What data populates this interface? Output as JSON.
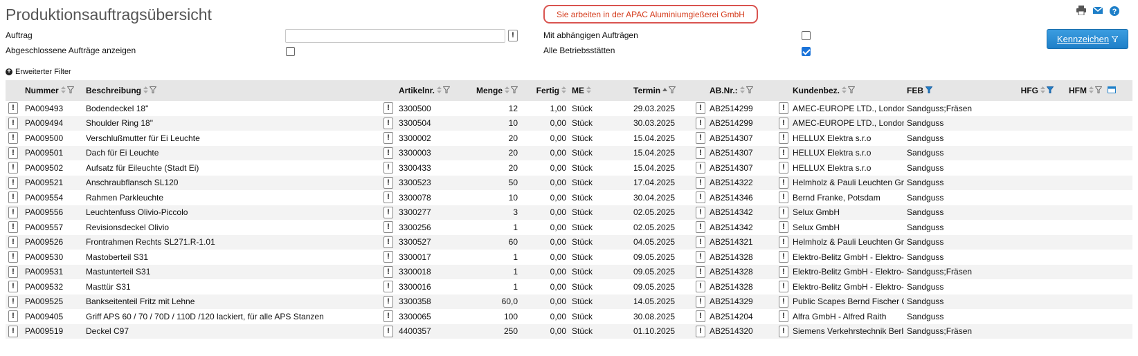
{
  "header": {
    "title": "Produktionsauftragsübersicht",
    "plant_notice": "Sie arbeiten in der APAC Aluminiumgießerei GmbH"
  },
  "filters": {
    "auftrag_label": "Auftrag",
    "auftrag_value": "",
    "abgeschlossene_label": "Abgeschlossene Aufträge anzeigen",
    "abgeschlossene_checked": false,
    "abhaengige_label": "Mit abhängigen Aufträgen",
    "abhaengige_checked": false,
    "betriebsstaetten_label": "Alle Betriebsstätten",
    "betriebsstaetten_checked": true,
    "kennzeichen_button": "Kennzeichen",
    "erweiterter_filter": "Erweiterter Filter",
    "info_button": "!"
  },
  "icons": {
    "print": "printer-icon",
    "mail": "mail-icon",
    "help": "help-icon",
    "sort": "sort-icon",
    "filter": "filter-icon",
    "export": "export-icon"
  },
  "colors": {
    "accent": "#1e7fc8",
    "notice": "#d43a1a",
    "header_bg": "#e6e6e6",
    "row_alt": "#f3f3f3"
  },
  "table": {
    "columns": {
      "nummer": "Nummer",
      "beschreibung": "Beschreibung",
      "artikelnr": "Artikelnr.",
      "menge": "Menge",
      "fertig": "Fertig",
      "me": "ME",
      "termin": "Termin",
      "abnr": "AB.Nr.:",
      "kunde": "Kundenbez.",
      "feb": "FEB",
      "hfg": "HFG",
      "hfm": "HFM"
    },
    "rows": [
      {
        "nummer": "PA009493",
        "beschreibung": "Bodendeckel 18\"",
        "artikelnr": "3300500",
        "menge": "12",
        "fertig": "1,00",
        "me": "Stück",
        "termin": "29.03.2025",
        "abnr": "AB2514299",
        "kunde": "AMEC-EUROPE LTD., London",
        "feb": "Sandguss;Fräsen"
      },
      {
        "nummer": "PA009494",
        "beschreibung": "Shoulder Ring 18\"",
        "artikelnr": "3300504",
        "menge": "10",
        "fertig": "0,00",
        "me": "Stück",
        "termin": "30.03.2025",
        "abnr": "AB2514299",
        "kunde": "AMEC-EUROPE LTD., London",
        "feb": "Sandguss"
      },
      {
        "nummer": "PA009500",
        "beschreibung": "Verschlußmutter für Ei Leuchte",
        "artikelnr": "3300002",
        "menge": "20",
        "fertig": "0,00",
        "me": "Stück",
        "termin": "15.04.2025",
        "abnr": "AB2514307",
        "kunde": "HELLUX Elektra s.r.o",
        "feb": "Sandguss"
      },
      {
        "nummer": "PA009501",
        "beschreibung": "Dach für Ei Leuchte",
        "artikelnr": "3300003",
        "menge": "20",
        "fertig": "0,00",
        "me": "Stück",
        "termin": "15.04.2025",
        "abnr": "AB2514307",
        "kunde": "HELLUX Elektra s.r.o",
        "feb": "Sandguss"
      },
      {
        "nummer": "PA009502",
        "beschreibung": "Aufsatz für Eileuchte (Stadt Ei)",
        "artikelnr": "3300433",
        "menge": "20",
        "fertig": "0,00",
        "me": "Stück",
        "termin": "15.04.2025",
        "abnr": "AB2514307",
        "kunde": "HELLUX Elektra s.r.o",
        "feb": "Sandguss"
      },
      {
        "nummer": "PA009521",
        "beschreibung": "Anschraubflansch SL120",
        "artikelnr": "3300523",
        "menge": "50",
        "fertig": "0,00",
        "me": "Stück",
        "termin": "17.04.2025",
        "abnr": "AB2514322",
        "kunde": "Helmholz & Pauli Leuchten GmbH",
        "feb": "Sandguss"
      },
      {
        "nummer": "PA009554",
        "beschreibung": "Rahmen Parkleuchte",
        "artikelnr": "3300078",
        "menge": "10",
        "fertig": "0,00",
        "me": "Stück",
        "termin": "30.04.2025",
        "abnr": "AB2514346",
        "kunde": "Bernd Franke, Potsdam",
        "feb": "Sandguss"
      },
      {
        "nummer": "PA009556",
        "beschreibung": "Leuchtenfuss Olivio-Piccolo",
        "artikelnr": "3300277",
        "menge": "3",
        "fertig": "0,00",
        "me": "Stück",
        "termin": "02.05.2025",
        "abnr": "AB2514342",
        "kunde": "Selux GmbH",
        "feb": "Sandguss"
      },
      {
        "nummer": "PA009557",
        "beschreibung": "Revisionsdeckel Olivio",
        "artikelnr": "3300256",
        "menge": "1",
        "fertig": "0,00",
        "me": "Stück",
        "termin": "02.05.2025",
        "abnr": "AB2514342",
        "kunde": "Selux GmbH",
        "feb": "Sandguss"
      },
      {
        "nummer": "PA009526",
        "beschreibung": "Frontrahmen Rechts SL271.R-1.01",
        "artikelnr": "3300527",
        "menge": "60",
        "fertig": "0,00",
        "me": "Stück",
        "termin": "04.05.2025",
        "abnr": "AB2514321",
        "kunde": "Helmholz & Pauli Leuchten GmbH",
        "feb": "Sandguss"
      },
      {
        "nummer": "PA009530",
        "beschreibung": "Mastoberteil S31",
        "artikelnr": "3300017",
        "menge": "1",
        "fertig": "0,00",
        "me": "Stück",
        "termin": "09.05.2025",
        "abnr": "AB2514328",
        "kunde": "Elektro-Belitz GmbH - Elektro-Belitz",
        "feb": "Sandguss"
      },
      {
        "nummer": "PA009531",
        "beschreibung": "Mastunterteil S31",
        "artikelnr": "3300018",
        "menge": "1",
        "fertig": "0,00",
        "me": "Stück",
        "termin": "09.05.2025",
        "abnr": "AB2514328",
        "kunde": "Elektro-Belitz GmbH - Elektro-Belitz",
        "feb": "Sandguss;Fräsen"
      },
      {
        "nummer": "PA009532",
        "beschreibung": "Masttür S31",
        "artikelnr": "3300016",
        "menge": "1",
        "fertig": "0,00",
        "me": "Stück",
        "termin": "09.05.2025",
        "abnr": "AB2514328",
        "kunde": "Elektro-Belitz GmbH - Elektro-Belitz",
        "feb": "Sandguss"
      },
      {
        "nummer": "PA009525",
        "beschreibung": "Bankseitenteil Fritz mit Lehne",
        "artikelnr": "3300358",
        "menge": "60,0",
        "fertig": "0,00",
        "me": "Stück",
        "termin": "14.05.2025",
        "abnr": "AB2514329",
        "kunde": "Public Scapes Bernd Fischer GmbH",
        "feb": "Sandguss"
      },
      {
        "nummer": "PA009405",
        "beschreibung": "Griff APS 60 / 70 / 70D / 110D /120 lackiert, für alle APS Stanzen",
        "artikelnr": "3300065",
        "menge": "100",
        "fertig": "0,00",
        "me": "Stück",
        "termin": "30.08.2025",
        "abnr": "AB2514204",
        "kunde": "Alfra GmbH - Alfred Raith",
        "feb": "Sandguss"
      },
      {
        "nummer": "PA009519",
        "beschreibung": "Deckel C97",
        "artikelnr": "4400357",
        "menge": "250",
        "fertig": "0,00",
        "me": "Stück",
        "termin": "01.10.2025",
        "abnr": "AB2514320",
        "kunde": "Siemens Verkehrstechnik Berlin",
        "feb": "Sandguss;Fräsen"
      }
    ]
  }
}
